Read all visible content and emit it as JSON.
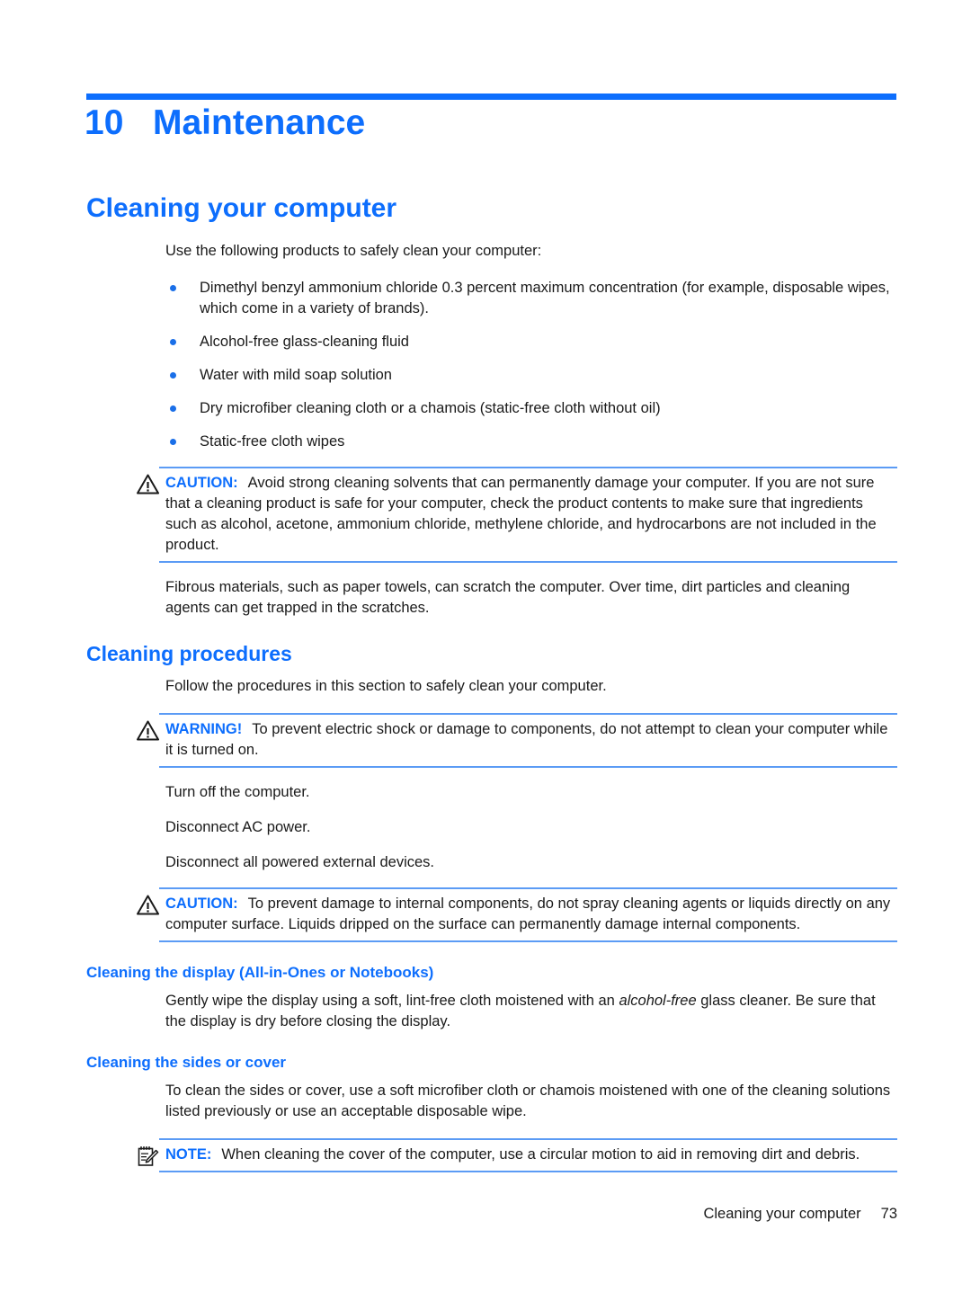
{
  "page": {
    "chapter_number": "10",
    "chapter_title": "Maintenance",
    "accent_color": "#0d6efd",
    "rule_color": "#5b9bf5",
    "bullet_color": "#1a6fe8"
  },
  "sections": {
    "cleaning_your_computer": {
      "heading": "Cleaning your computer",
      "intro": "Use the following products to safely clean your computer:",
      "bullets": [
        "Dimethyl benzyl ammonium chloride 0.3 percent maximum concentration (for example, disposable wipes, which come in a variety of brands).",
        "Alcohol-free glass-cleaning fluid",
        "Water with mild soap solution",
        "Dry microfiber cleaning cloth or a chamois (static-free cloth without oil)",
        "Static-free cloth wipes"
      ],
      "caution": {
        "icon": "warning-triangle-icon",
        "label": "CAUTION:",
        "text": "Avoid strong cleaning solvents that can permanently damage your computer. If you are not sure that a cleaning product is safe for your computer, check the product contents to make sure that ingredients such as alcohol, acetone, ammonium chloride, methylene chloride, and hydrocarbons are not included in the product."
      },
      "after_caution": "Fibrous materials, such as paper towels, can scratch the computer. Over time, dirt particles and cleaning agents can get trapped in the scratches."
    },
    "cleaning_procedures": {
      "heading": "Cleaning procedures",
      "intro": "Follow the procedures in this section to safely clean your computer.",
      "warning": {
        "icon": "warning-triangle-icon",
        "label": "WARNING!",
        "text": "To prevent electric shock or damage to components, do not attempt to clean your computer while it is turned on."
      },
      "steps": [
        "Turn off the computer.",
        "Disconnect AC power.",
        "Disconnect all powered external devices."
      ],
      "caution": {
        "icon": "warning-triangle-icon",
        "label": "CAUTION:",
        "text": "To prevent damage to internal components, do not spray cleaning agents or liquids directly on any computer surface. Liquids dripped on the surface can permanently damage internal components."
      },
      "display_sub": {
        "heading": "Cleaning the display (All-in-Ones or Notebooks)",
        "text_before_italic": "Gently wipe the display using a soft, lint-free cloth moistened with an ",
        "italic_text": "alcohol-free",
        "text_after_italic": " glass cleaner. Be sure that the display is dry before closing the display."
      },
      "sides_sub": {
        "heading": "Cleaning the sides or cover",
        "text": "To clean the sides or cover, use a soft microfiber cloth or chamois moistened with one of the cleaning solutions listed previously or use an acceptable disposable wipe.",
        "note": {
          "icon": "notepad-pencil-icon",
          "label": "NOTE:",
          "text": "When cleaning the cover of the computer, use a circular motion to aid in removing dirt and debris."
        }
      }
    }
  },
  "footer": {
    "running_head": "Cleaning your computer",
    "page_number": "73"
  }
}
